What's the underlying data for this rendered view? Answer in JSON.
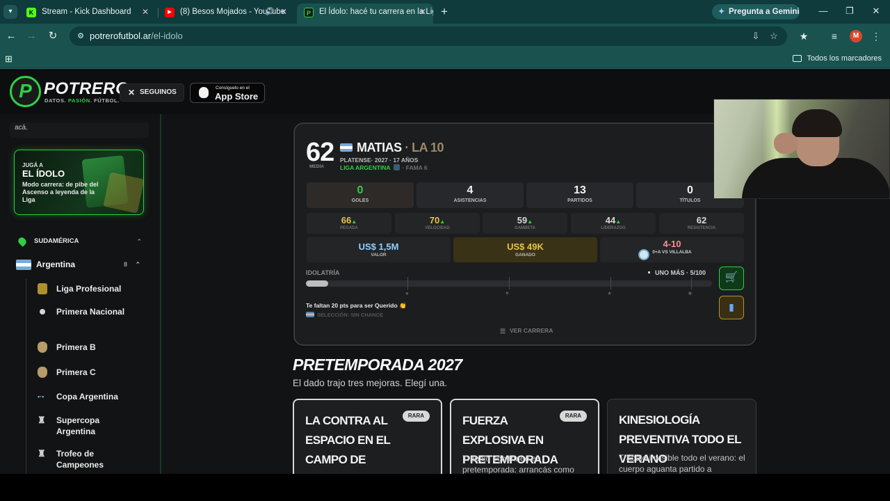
{
  "browser": {
    "tabs": [
      {
        "title": "Stream - Kick Dashboard",
        "favicon": "K"
      },
      {
        "title": "(8) Besos Mojados - YouTube",
        "favicon": "▶"
      },
      {
        "title": "El Ídolo: hacé tu carrera en la Liga",
        "favicon": "P"
      }
    ],
    "gemini_label": "Pregunta a Gemini",
    "url_host": "potrerofutbol.ar",
    "url_path": "/el-idolo",
    "avatar_letter": "M",
    "bookmarks_label": "Todos los marcadores"
  },
  "header": {
    "logo_text": "POTRERO",
    "logo_sub_1": "DATOS.",
    "logo_sub_2": "PASIÓN.",
    "logo_sub_3": "FÚTBOL.",
    "follow_label": "SEGUINOS",
    "appstore_small": "Consíguelo en el",
    "appstore_big": "App Store"
  },
  "sidebar": {
    "search_stub": "acá.",
    "promo": {
      "kicker": "JUGÁ A",
      "title": "EL ÍDOLO",
      "desc": "Modo carrera: de pibe del Ascenso a leyenda de la Liga"
    },
    "region": "SUDAMÉRICA",
    "country": "Argentina",
    "country_count": "8",
    "items": [
      {
        "label": "Liga Profesional"
      },
      {
        "label": "Primera Nacional"
      },
      {
        "label": "Primera B"
      },
      {
        "label": "Primera C"
      },
      {
        "label": "Copa Argentina"
      },
      {
        "label": "Supercopa Argentina"
      },
      {
        "label": "Trofeo de Campeones"
      }
    ]
  },
  "player": {
    "overall": "62",
    "overall_label": "MEDIA",
    "name": "MATIAS",
    "nickname": "· LA 10",
    "meta": "PLATENSE· 2027 · 17 AÑOS",
    "league": "LIGA ARGENTINA",
    "fame": "· FAMA 6",
    "stats": [
      {
        "value": "0",
        "label": "GOLES",
        "color": "#2fcf46"
      },
      {
        "value": "4",
        "label": "ASISTENCIAS",
        "color": "#f2f2f2"
      },
      {
        "value": "13",
        "label": "PARTIDOS",
        "color": "#f2f2f2"
      },
      {
        "value": "0",
        "label": "TÍTULOS",
        "color": "#f2f2f2"
      }
    ],
    "attributes": [
      {
        "value": "66",
        "label": "PEGADA",
        "up": "▲",
        "color": "#e6c54a"
      },
      {
        "value": "70",
        "label": "VELOCIDAD",
        "up": "▲",
        "color": "#e6c54a"
      },
      {
        "value": "59",
        "label": "GAMBETA",
        "up": "▲",
        "color": "#d9d9d9"
      },
      {
        "value": "44",
        "label": "LIDERAZGO",
        "up": "▲",
        "color": "#d9d9d9"
      },
      {
        "value": "62",
        "label": "RESISTENCIA",
        "up": "",
        "color": "#d9d9d9"
      }
    ],
    "money": [
      {
        "value": "US$ 1,5M",
        "label": "VALOR",
        "color": "#8fd0ff"
      },
      {
        "value": "US$ 49K",
        "label": "GANADO",
        "color": "#e6c54a"
      },
      {
        "value": "4-10",
        "label": "0+A VS VILLALBA",
        "color": "#ff8f8f"
      }
    ],
    "idolatria_label": "IDOLATRÍA",
    "idolatria_right": "UNO MÁS · 5/100",
    "idolatria_progress": 0.05,
    "faltan": "Te faltan 20 pts para ser Querido 👏",
    "seleccion": "SELECCIÓN: SIN CHANCE",
    "ver_carrera": "VER CARRERA"
  },
  "pretemporada": {
    "title": "PRETEMPORADA 2027",
    "subtitle": "El dado trajo tres mejoras. Elegí una.",
    "options": [
      {
        "title": "LA CONTRA AL ESPACIO EN EL CAMPO DE ENTRENAMIENTO",
        "badge": "RARA",
        "desc": ""
      },
      {
        "title": "FUERZA EXPLOSIVA EN PRETEMPORADA",
        "badge": "RARA",
        "desc": "Trabajo con trineo en pretemporada: arrancás como"
      },
      {
        "title": "KINESIOLOGÍA PREVENTIVA TODO EL VERANO",
        "badge": "",
        "desc": "Trabajo invisible todo el verano: el cuerpo aguanta partido a"
      }
    ]
  }
}
